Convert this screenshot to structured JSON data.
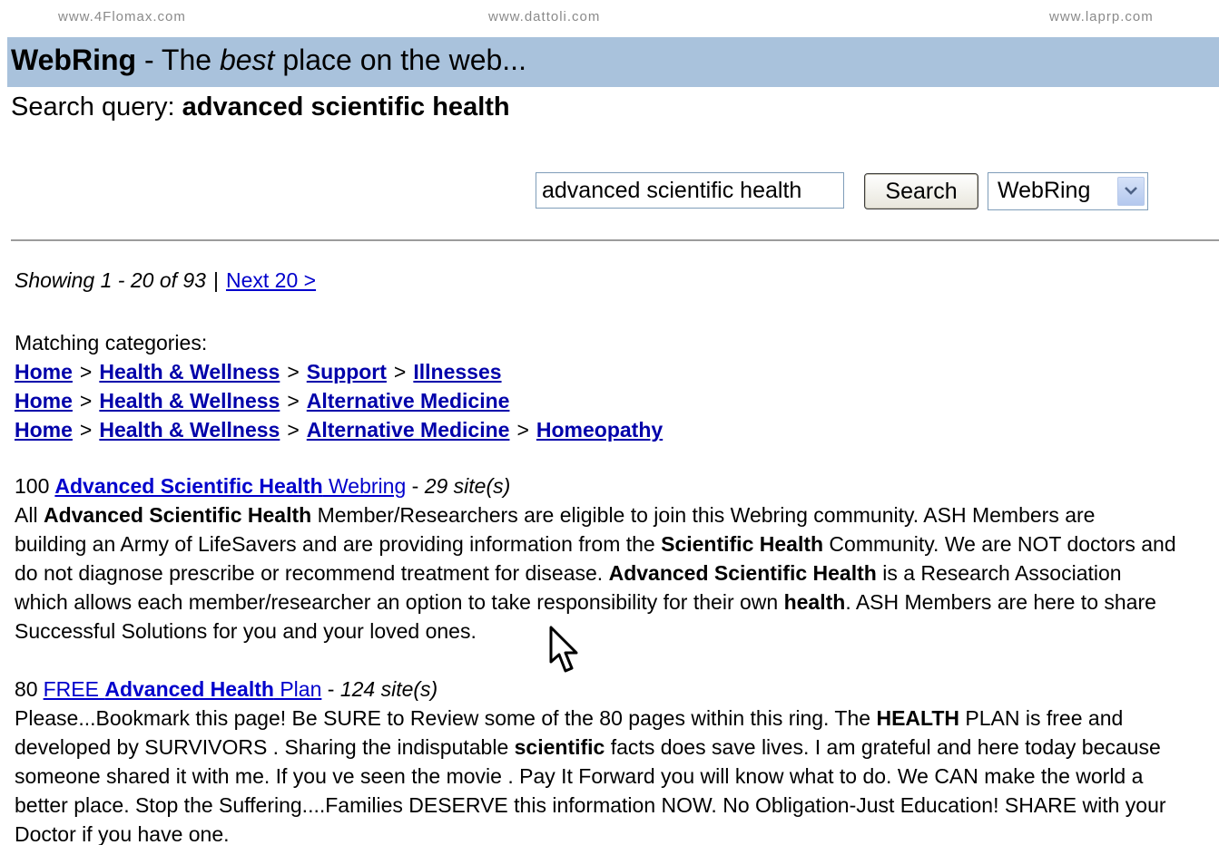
{
  "top_links": [
    "www.4Flomax.com",
    "www.dattoli.com",
    "www.laprp.com"
  ],
  "header": {
    "brand": "WebRing",
    "dash": " - The ",
    "emph": "best",
    "rest": " place on the web..."
  },
  "query": {
    "label": "Search query: ",
    "value": "advanced scientific health"
  },
  "search": {
    "input_value": "advanced scientific health",
    "button_label": "Search",
    "scope_value": "WebRing"
  },
  "pagination": {
    "showing": "Showing 1 - 20 of 93",
    "separator": "|",
    "next_label": "Next 20 >"
  },
  "categories": {
    "label": "Matching categories:",
    "separator": ">",
    "paths": [
      [
        "Home",
        "Health & Wellness",
        "Support",
        "Illnesses"
      ],
      [
        "Home",
        "Health & Wellness",
        "Alternative Medicine"
      ],
      [
        "Home",
        "Health & Wellness",
        "Alternative Medicine",
        "Homeopathy"
      ]
    ]
  },
  "results": [
    {
      "rating": "100",
      "title_bold": "Advanced Scientific Health",
      "title_rest": " Webring",
      "dash": " - ",
      "count": "29 site(s)",
      "desc_lines": [
        [
          {
            "t": "All ",
            "b": false
          },
          {
            "t": "Advanced Scientific Health",
            "b": true
          },
          {
            "t": " Member/Researchers are eligible to join this Webring community. ASH Members are",
            "b": false
          }
        ],
        [
          {
            "t": "building an Army of LifeSavers and are providing information from the ",
            "b": false
          },
          {
            "t": "Scientific Health",
            "b": true
          },
          {
            "t": " Community. We are NOT doctors and",
            "b": false
          }
        ],
        [
          {
            "t": "do not diagnose prescribe or recommend treatment for disease. ",
            "b": false
          },
          {
            "t": "Advanced Scientific Health",
            "b": true
          },
          {
            "t": " is a Research Association",
            "b": false
          }
        ],
        [
          {
            "t": "which allows each member/researcher an option to take responsibility for their own ",
            "b": false
          },
          {
            "t": "health",
            "b": true
          },
          {
            "t": ". ASH Members are here to share",
            "b": false
          }
        ],
        [
          {
            "t": "Successful Solutions for you and your loved ones.",
            "b": false
          }
        ]
      ]
    },
    {
      "rating": "80",
      "title_pre": "FREE ",
      "title_bold": "Advanced Health",
      "title_rest": " Plan",
      "dash": " - ",
      "count": "124 site(s)",
      "desc_lines": [
        [
          {
            "t": "Please...Bookmark this page! Be SURE to Review some of the 80 pages within this ring. The ",
            "b": false
          },
          {
            "t": "HEALTH",
            "b": true
          },
          {
            "t": " PLAN is free and",
            "b": false
          }
        ],
        [
          {
            "t": "developed by SURVIVORS . Sharing the indisputable ",
            "b": false
          },
          {
            "t": "scientific",
            "b": true
          },
          {
            "t": " facts does save lives. I am grateful and here today because",
            "b": false
          }
        ],
        [
          {
            "t": "someone shared it with me. If you ve seen the movie . Pay It Forward you will know what to do. We CAN make the world a",
            "b": false
          }
        ],
        [
          {
            "t": "better place. Stop the Suffering....Families DESERVE this information NOW. No Obligation-Just Education! SHARE with your",
            "b": false
          }
        ],
        [
          {
            "t": "Doctor if you have one.",
            "b": false
          }
        ]
      ]
    }
  ],
  "colors": {
    "title_bar": "#a9c2dc",
    "link": "#0000cc",
    "category_link": "#0000aa",
    "top_link": "#8a8a8a"
  },
  "icons": {
    "dropdown": "chevron-down-icon",
    "cursor": "mouse-pointer-icon"
  }
}
